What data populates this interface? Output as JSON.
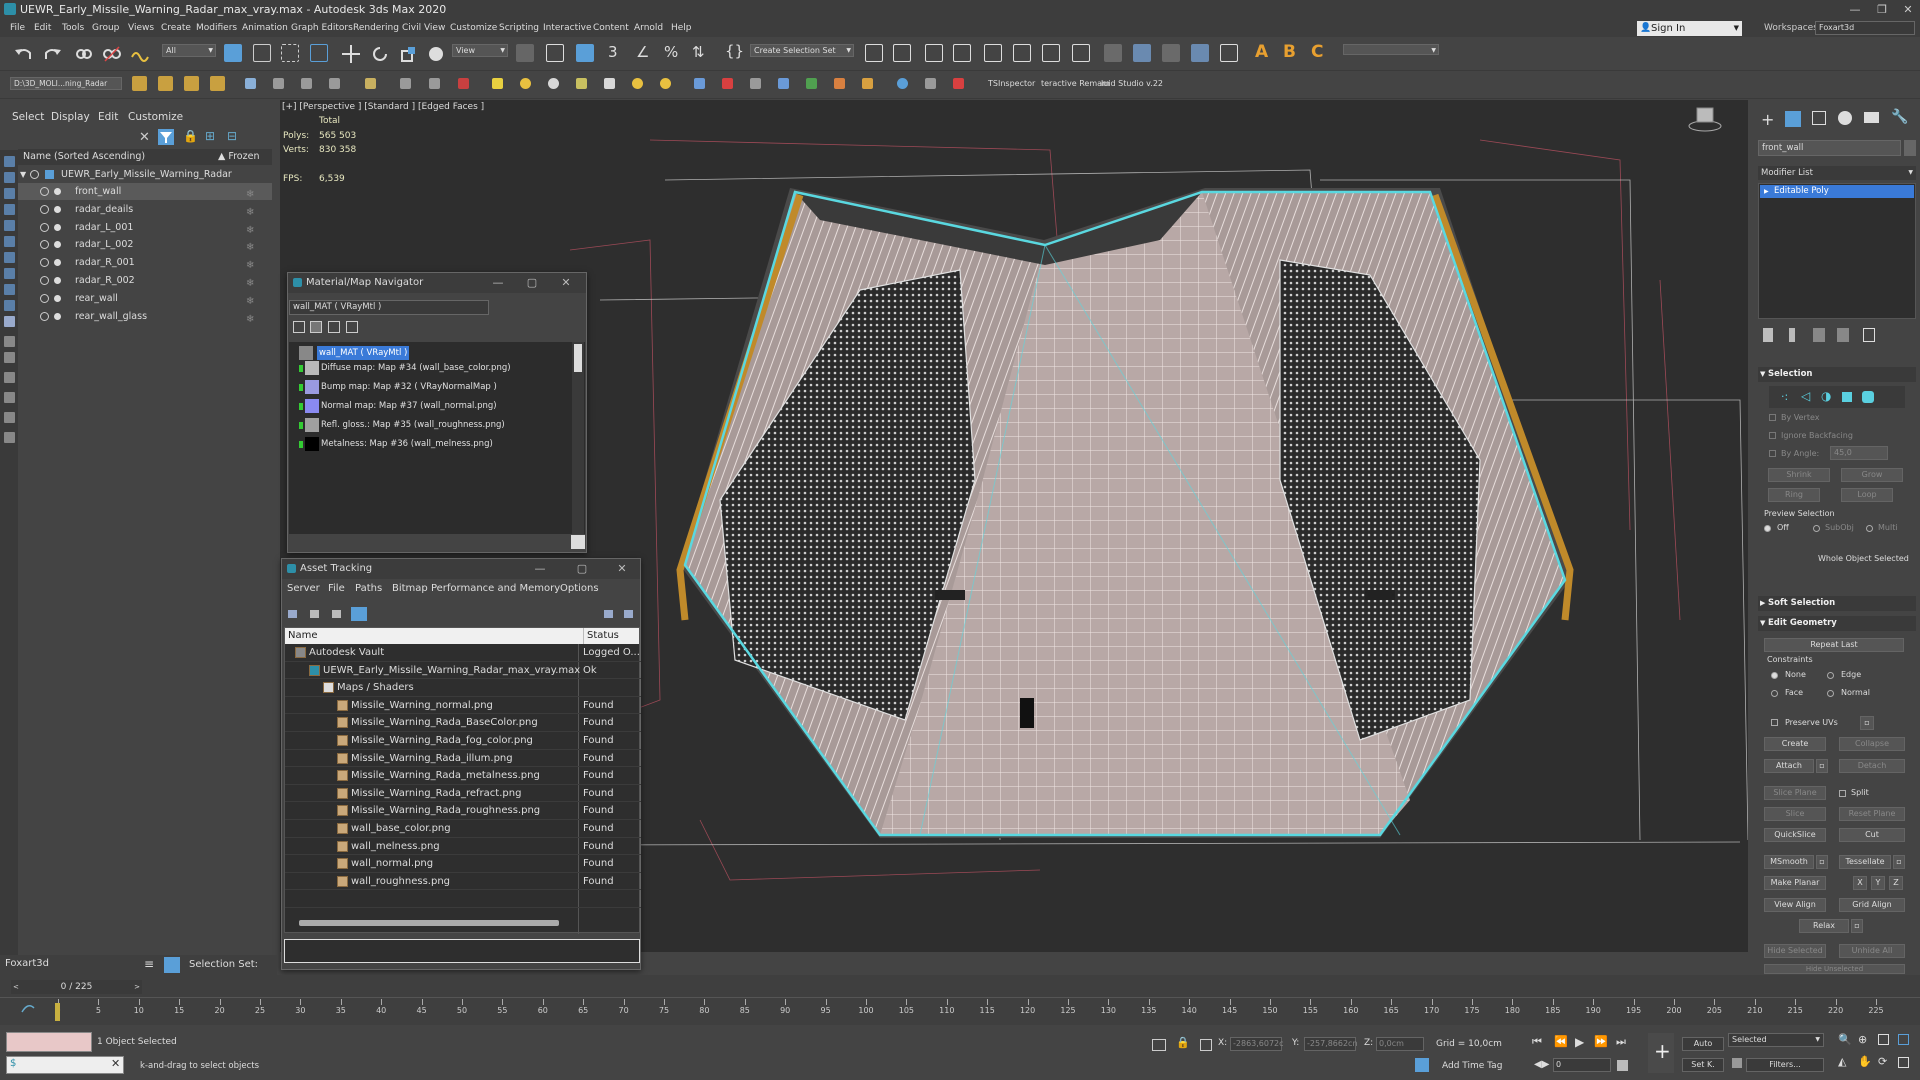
{
  "window": {
    "title": "UEWR_Early_Missile_Warning_Radar_max_vray.max - Autodesk 3ds Max 2020"
  },
  "menu": [
    "File",
    "Edit",
    "Tools",
    "Group",
    "Views",
    "Create",
    "Modifiers",
    "Animation",
    "Graph Editors",
    "Rendering",
    "Civil View",
    "Customize",
    "Scripting",
    "Interactive",
    "Content",
    "Arnold",
    "Help"
  ],
  "header": {
    "sign_in": "Sign In",
    "workspaces_label": "Workspaces:",
    "workspace": "Foxart3d"
  },
  "toolbar": {
    "filter_all": "All",
    "view": "View",
    "create_selection_set": "Create Selection Set",
    "path": "D:\\3D_MOLI...ning_Radar",
    "tsinspector": "TSInspector",
    "interactive_remap": "teractive Remam",
    "fluid_studio": "luid Studio v.22"
  },
  "scene_explorer": {
    "tabs": [
      "Select",
      "Display",
      "Edit",
      "Customize"
    ],
    "column_name": "Name (Sorted Ascending)",
    "column_frozen": "▲ Frozen",
    "root": "UEWR_Early_Missile_Warning_Radar",
    "items": [
      "front_wall",
      "radar_deails",
      "radar_L_001",
      "radar_L_002",
      "radar_R_001",
      "radar_R_002",
      "rear_wall",
      "rear_wall_glass"
    ],
    "selected_index": 0,
    "layer": "Foxart3d",
    "selection_set_label": "Selection Set:"
  },
  "viewport": {
    "label": "[+] [Perspective ] [Standard ] [Edged Faces ]",
    "stats_total": "Total",
    "polys_label": "Polys:",
    "polys_value": "565 503",
    "verts_label": "Verts:",
    "verts_value": "830 358",
    "fps_label": "FPS:",
    "fps_value": "6,539"
  },
  "material_navigator": {
    "title": "Material/Map Navigator",
    "field": "wall_MAT  ( VRayMtl )",
    "root": "wall_MAT  ( VRayMtl )",
    "maps": [
      {
        "label": "Diffuse map: Map #34 (wall_base_color.png)",
        "color": "#b8b8b8"
      },
      {
        "label": "Bump map: Map #32  ( VRayNormalMap )",
        "color": "#9a9ae0"
      },
      {
        "label": "Normal map: Map #37 (wall_normal.png)",
        "color": "#8a8af0"
      },
      {
        "label": "Refl. gloss.: Map #35 (wall_roughness.png)",
        "color": "#a0a0a0"
      },
      {
        "label": "Metalness: Map #36 (wall_melness.png)",
        "color": "#000000"
      }
    ]
  },
  "asset_tracking": {
    "title": "Asset Tracking",
    "menu": [
      "Server",
      "File",
      "Paths",
      "Bitmap Performance and Memory",
      "Options"
    ],
    "col_name": "Name",
    "col_status": "Status",
    "rows": [
      {
        "name": "Autodesk Vault",
        "status": "Logged O...",
        "indent": 1,
        "icon": "vault"
      },
      {
        "name": "UEWR_Early_Missile_Warning_Radar_max_vray.max",
        "status": "Ok",
        "indent": 2,
        "icon": "max"
      },
      {
        "name": "Maps / Shaders",
        "status": "",
        "indent": 3,
        "icon": "folder"
      },
      {
        "name": "Missile_Warning_normal.png",
        "status": "Found",
        "indent": 4,
        "icon": "file"
      },
      {
        "name": "Missile_Warning_Rada_BaseColor.png",
        "status": "Found",
        "indent": 4,
        "icon": "file"
      },
      {
        "name": "Missile_Warning_Rada_fog_color.png",
        "status": "Found",
        "indent": 4,
        "icon": "file"
      },
      {
        "name": "Missile_Warning_Rada_illum.png",
        "status": "Found",
        "indent": 4,
        "icon": "file"
      },
      {
        "name": "Missile_Warning_Rada_metalness.png",
        "status": "Found",
        "indent": 4,
        "icon": "file"
      },
      {
        "name": "Missile_Warning_Rada_refract.png",
        "status": "Found",
        "indent": 4,
        "icon": "file"
      },
      {
        "name": "Missile_Warning_Rada_roughness.png",
        "status": "Found",
        "indent": 4,
        "icon": "file"
      },
      {
        "name": "wall_base_color.png",
        "status": "Found",
        "indent": 4,
        "icon": "file"
      },
      {
        "name": "wall_melness.png",
        "status": "Found",
        "indent": 4,
        "icon": "file"
      },
      {
        "name": "wall_normal.png",
        "status": "Found",
        "indent": 4,
        "icon": "file"
      },
      {
        "name": "wall_roughness.png",
        "status": "Found",
        "indent": 4,
        "icon": "file"
      }
    ]
  },
  "command_panel": {
    "object_name": "front_wall",
    "modifier_list": "Modifier List",
    "stack": [
      "Editable Poly"
    ],
    "selection_header": "Selection",
    "by_vertex": "By Vertex",
    "ignore_backfacing": "Ignore Backfacing",
    "by_angle": "By Angle:",
    "angle_value": "45,0",
    "shrink": "Shrink",
    "grow": "Grow",
    "ring": "Ring",
    "loop": "Loop",
    "preview_selection": "Preview Selection",
    "preview_off": "Off",
    "preview_subobj": "SubObj",
    "preview_multi": "Multi",
    "whole_object_selected": "Whole Object Selected",
    "soft_selection": "Soft Selection",
    "edit_geometry": "Edit Geometry",
    "repeat_last": "Repeat Last",
    "constraints": "Constraints",
    "c_none": "None",
    "c_edge": "Edge",
    "c_face": "Face",
    "c_normal": "Normal",
    "preserve_uvs": "Preserve UVs",
    "create": "Create",
    "collapse": "Collapse",
    "attach": "Attach",
    "detach": "Detach",
    "slice_plane": "Slice Plane",
    "split": "Split",
    "slice": "Slice",
    "reset_plane": "Reset Plane",
    "quickslice": "QuickSlice",
    "cut": "Cut",
    "msmooth": "MSmooth",
    "tessellate": "Tessellate",
    "make_planar": "Make Planar",
    "x": "X",
    "y": "Y",
    "z": "Z",
    "view_align": "View Align",
    "grid_align": "Grid Align",
    "relax": "Relax",
    "hide_selected": "Hide Selected",
    "unhide_all": "Unhide All",
    "hide_unselected": "Hide Unselected"
  },
  "timeline": {
    "frame_display": "0 / 225",
    "ticks": [
      "0",
      "5",
      "10",
      "15",
      "20",
      "25",
      "30",
      "35",
      "40",
      "45",
      "50",
      "55",
      "60",
      "65",
      "70",
      "75",
      "80",
      "85",
      "90",
      "95",
      "100",
      "105",
      "110",
      "115",
      "120",
      "125",
      "130",
      "135",
      "140",
      "145",
      "150",
      "155",
      "160",
      "165",
      "170",
      "175",
      "180",
      "185",
      "190",
      "195",
      "200",
      "205",
      "210",
      "215",
      "220",
      "225"
    ]
  },
  "status": {
    "objects_selected": "1 Object Selected",
    "prompt": "k-and-drag to select objects",
    "x_label": "X:",
    "x_value": "-2863,6072c",
    "y_label": "Y:",
    "y_value": "-257,8662cn",
    "z_label": "Z:",
    "z_value": "0,0cm",
    "grid": "Grid = 10,0cm",
    "add_time_tag": "Add Time Tag",
    "auto": "Auto",
    "set_key": "Set K.",
    "selected": "Selected",
    "filters": "Filters...",
    "frame": "0"
  },
  "colors": {
    "accent": "#5a9fd8",
    "selection_outline": "#5ad8e0",
    "truss": "#c08a2a"
  }
}
